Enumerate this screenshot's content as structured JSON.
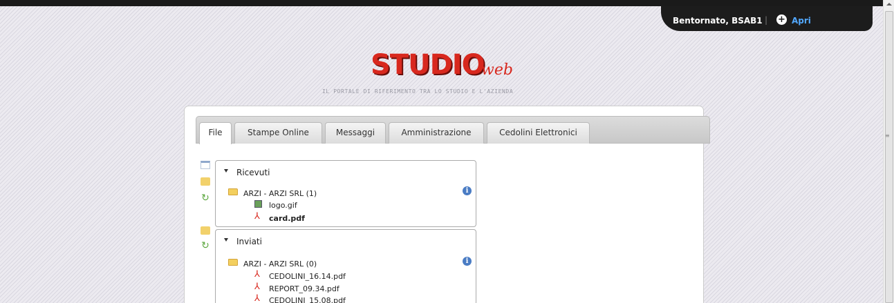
{
  "header": {
    "welcome": "Bentornato, BSAB1",
    "separator": "|",
    "open_icon": "plus-circle-icon",
    "open_label": "Apri"
  },
  "brand": {
    "logo_main": "STUDIO",
    "logo_suffix": "web",
    "tagline": "IL PORTALE DI RIFERIMENTO TRA LO STUDIO E L'AZIENDA"
  },
  "tabs": [
    {
      "label": "File",
      "active": true
    },
    {
      "label": "Stampe Online",
      "active": false
    },
    {
      "label": "Messaggi",
      "active": false
    },
    {
      "label": "Amministrazione",
      "active": false
    },
    {
      "label": "Cedolini Elettronici",
      "active": false
    }
  ],
  "received": {
    "title": "Ricevuti",
    "folder": "ARZI - ARZI SRL (1)",
    "files": [
      {
        "name": "logo.gif",
        "icon": "image-icon",
        "bold": false
      },
      {
        "name": "card.pdf",
        "icon": "pdf-icon",
        "bold": true
      }
    ]
  },
  "sent": {
    "title": "Inviati",
    "folder": "ARZI - ARZI SRL (0)",
    "files": [
      {
        "name": "CEDOLINI_16.14.pdf",
        "icon": "pdf-icon"
      },
      {
        "name": "REPORT_09.34.pdf",
        "icon": "pdf-icon"
      },
      {
        "name": "CEDOLINI_15.08.pdf",
        "icon": "pdf-icon"
      }
    ]
  },
  "colors": {
    "brand_red": "#d8281e",
    "link_blue": "#52a8ff",
    "info_blue": "#4a7cc4"
  }
}
